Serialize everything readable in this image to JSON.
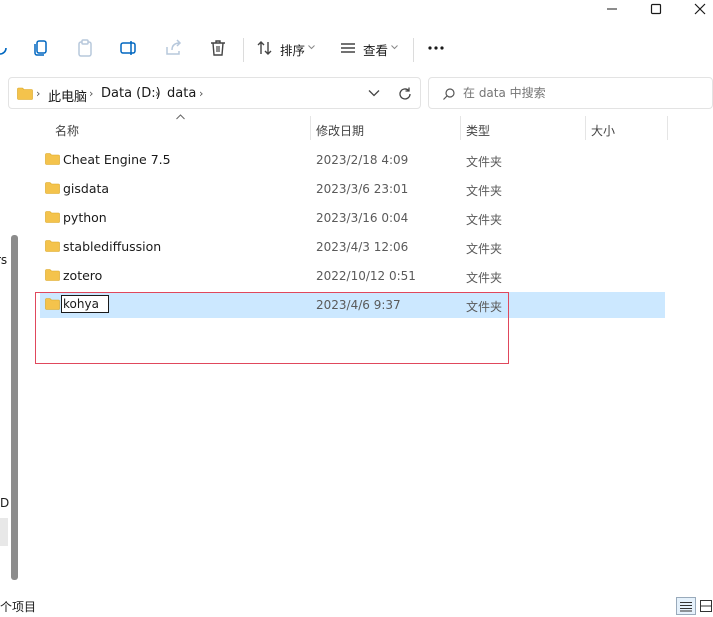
{
  "window": {
    "controls": [
      "minimize-icon",
      "maximize-icon",
      "close-icon"
    ]
  },
  "toolbar": {
    "sort_label": "排序",
    "view_label": "查看",
    "icons": [
      "new-icon",
      "copy-icon",
      "paste-icon",
      "rename-icon",
      "share-icon",
      "delete-icon",
      "sort-icon",
      "view-icon",
      "more-icon"
    ]
  },
  "address": {
    "crumbs": [
      "此电脑",
      "Data (D:)",
      "data"
    ]
  },
  "search": {
    "placeholder": "在 data 中搜索"
  },
  "columns": {
    "name": "名称",
    "date": "修改日期",
    "type": "类型",
    "size": "大小"
  },
  "files": [
    {
      "name": "Cheat Engine 7.5",
      "date": "2023/2/18 4:09",
      "type": "文件夹"
    },
    {
      "name": "gisdata",
      "date": "2023/3/6 23:01",
      "type": "文件夹"
    },
    {
      "name": "python",
      "date": "2023/3/16 0:04",
      "type": "文件夹"
    },
    {
      "name": "stablediffussion",
      "date": "2023/4/3 12:06",
      "type": "文件夹"
    },
    {
      "name": "zotero",
      "date": "2022/10/12 0:51",
      "type": "文件夹"
    },
    {
      "name": "kohya",
      "date": "2023/4/6 9:37",
      "type": "文件夹"
    }
  ],
  "nav_fragments": [
    "rs",
    "D"
  ],
  "status": {
    "items_text": "个项目"
  },
  "colors": {
    "selection": "#cce8ff",
    "highlight_box": "#e0485c",
    "folder": "#f4c34c"
  }
}
